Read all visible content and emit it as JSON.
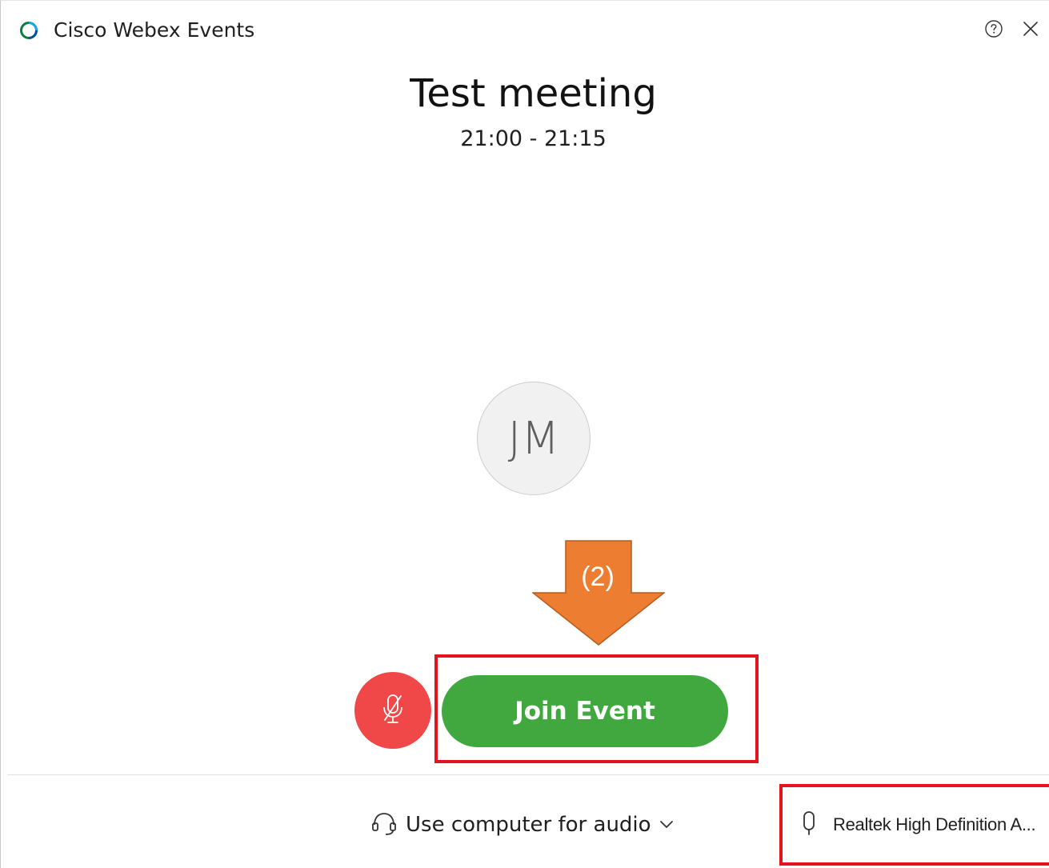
{
  "window": {
    "app_title": "Cisco Webex Events"
  },
  "meeting": {
    "title": "Test meeting",
    "time": "21:00 - 21:15"
  },
  "avatar": {
    "initials": "JM"
  },
  "annotation": {
    "step_label": "(2)",
    "arrow_color": "#ed7d31",
    "highlight_color": "#e3141c"
  },
  "actions": {
    "join_label": "Join Event",
    "join_color": "#41a83f",
    "mute_color": "#f04848"
  },
  "footer": {
    "audio_label": "Use computer for audio",
    "mic_label": "Realtek High Definition A..."
  },
  "icons": {
    "app_logo": "webex-logo-icon",
    "help": "help-icon",
    "close": "close-icon",
    "mute": "microphone-muted-icon",
    "headset": "headset-icon",
    "chevron": "chevron-down-icon",
    "microphone": "microphone-icon"
  }
}
